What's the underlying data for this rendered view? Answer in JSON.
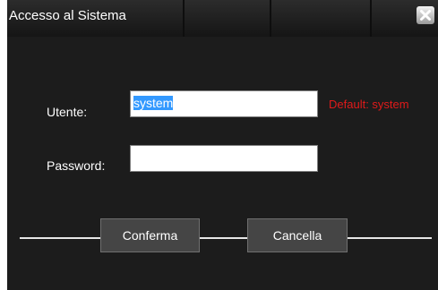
{
  "window": {
    "title": "Accesso al Sistema",
    "close_icon": "close-icon"
  },
  "form": {
    "user_label": "Utente:",
    "user_value": "system",
    "user_hint": "Default: system",
    "password_label": "Password:",
    "password_value": ""
  },
  "buttons": {
    "confirm_label": "Conferma",
    "cancel_label": "Cancella"
  },
  "colors": {
    "background": "#1c1c1c",
    "hint": "#e01a1a",
    "selection": "#3399ff",
    "button": "#454545"
  }
}
